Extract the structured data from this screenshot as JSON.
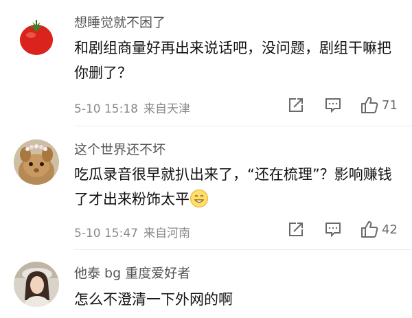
{
  "comments": [
    {
      "username": "想睡觉就不困了",
      "text": "和剧组商量好再出来说话吧，没问题，剧组干嘛把你删了？",
      "date": "5-10 15:18",
      "location": "来自天津",
      "likes": "71",
      "avatar_icon": "tomato-avatar"
    },
    {
      "username": "这个世界还不坏",
      "text": "吃瓜录音很早就扒出来了，“还在梳理”？影响赚钱了才出来粉饰太平",
      "date": "5-10 15:47",
      "location": "来自河南",
      "likes": "42",
      "avatar_icon": "rabbit-avatar",
      "emoji": "smile-emoji"
    },
    {
      "username": "他泰 bg 重度爱好者",
      "text": "怎么不澄清一下外网的啊",
      "avatar_icon": "woman-portrait-avatar"
    }
  ],
  "icons": {
    "share": "share-icon",
    "reply": "comment-icon",
    "like": "thumbs-up-icon"
  },
  "colors": {
    "username": "#555555",
    "meta": "#8a8a8a",
    "text": "#111111"
  }
}
